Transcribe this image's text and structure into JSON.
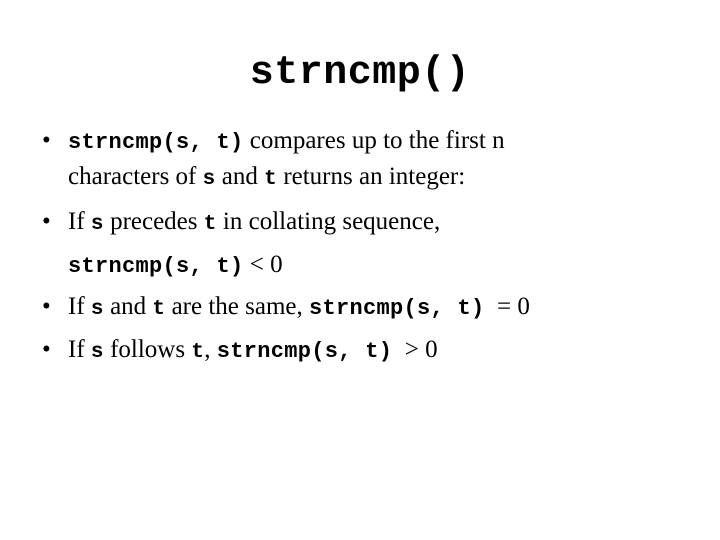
{
  "slide": {
    "title": "strncmp()",
    "bullet_marker": "•",
    "bullets": [
      {
        "id": "bullet-compares",
        "line1": {
          "code": "strncmp(s, t)",
          "rest": "  compares up to the first n"
        },
        "line2": {
          "pre": "characters of ",
          "code_s": "s",
          "mid": " and ",
          "code_t": "t",
          "post": " returns an integer:"
        }
      },
      {
        "id": "bullet-precedes",
        "line1": {
          "pre": "If ",
          "code_s": "s",
          "mid": " precedes ",
          "code_t": "t",
          "post": " in collating sequence,"
        },
        "subline": {
          "code": "strncmp(s, t)",
          "operator": " < 0"
        }
      },
      {
        "id": "bullet-same",
        "line1": {
          "pre": "If ",
          "code_s": "s",
          "mid": " and ",
          "code_t": "t",
          "post": " are the same, ",
          "code": "strncmp(s, t)",
          "operator": "  = 0"
        }
      },
      {
        "id": "bullet-follows",
        "line1": {
          "pre": "If ",
          "code_s": "s",
          "mid": " follows ",
          "code_t": "t",
          "post": ", ",
          "code": "strncmp(s, t)",
          "operator": "  > 0"
        }
      }
    ]
  }
}
